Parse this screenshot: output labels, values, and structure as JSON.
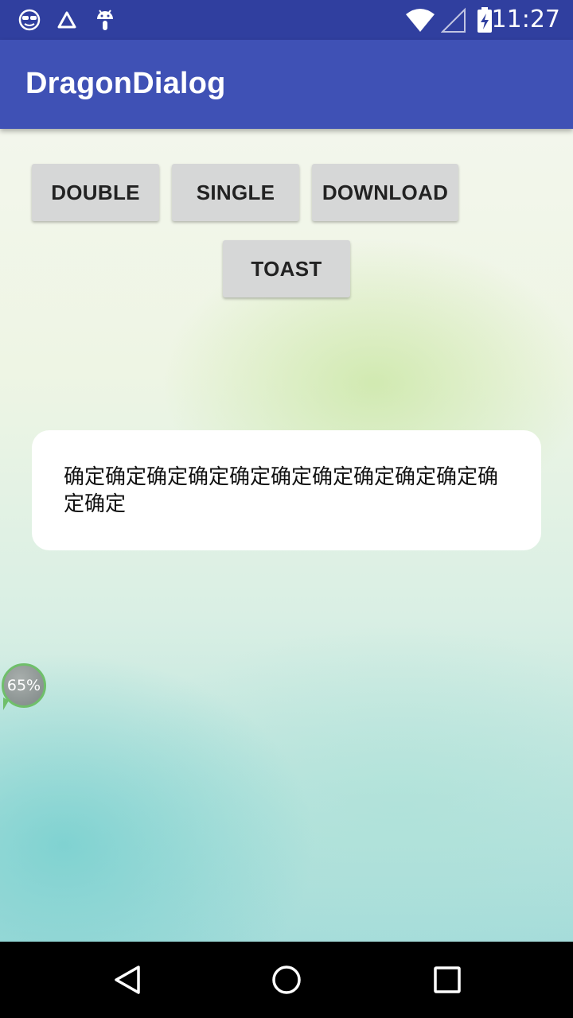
{
  "status_bar": {
    "time": "11:27",
    "left_icons": [
      "sunglasses-face-icon",
      "triangle-warning-icon",
      "android-debug-icon"
    ],
    "right_icons": [
      "wifi-icon",
      "cell-signal-icon",
      "battery-charging-icon"
    ]
  },
  "app_bar": {
    "title": "DragonDialog"
  },
  "buttons": {
    "double": "DOUBLE",
    "single": "SINGLE",
    "download": "DOWNLOAD",
    "toast": "TOAST"
  },
  "dialog": {
    "message": "确定确定确定确定确定确定确定确定确定确定确定确定"
  },
  "floating_badge": {
    "label": "65%"
  },
  "nav_bar": {
    "icons": [
      "back-icon",
      "home-icon",
      "recents-icon"
    ]
  },
  "colors": {
    "status_bar": "#303F9F",
    "app_bar": "#3F51B5",
    "button_bg": "#D6D7D7",
    "dialog_bg": "#FFFFFF",
    "badge_border": "#6FBF6A"
  }
}
